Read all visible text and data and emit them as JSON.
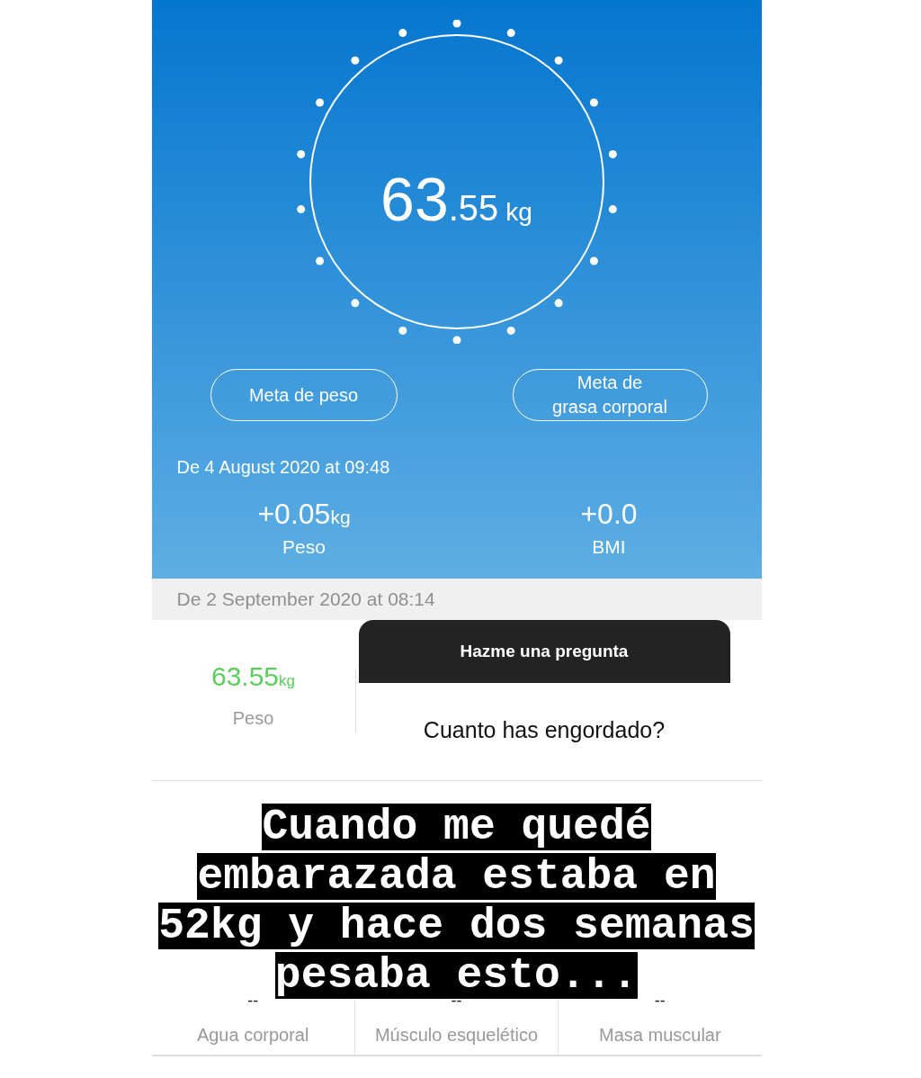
{
  "app": {
    "weight": {
      "whole": "63",
      "decimal": ".55",
      "unit": "kg"
    },
    "goal_buttons": [
      "Meta de peso",
      "Meta de\ngrasa corporal"
    ],
    "since": "De 4 August 2020 at 09:48",
    "changes": [
      {
        "value": "+0.05",
        "unit": "kg",
        "label": "Peso"
      },
      {
        "value": "+0.0",
        "label": "BMI"
      }
    ],
    "date": "De 2 September 2020 at 08:14",
    "current": {
      "value": "63.55",
      "unit": "kg",
      "label": "Peso"
    },
    "metrics": [
      {
        "value": "--",
        "label": "Agua corporal"
      },
      {
        "value": "--",
        "label": "Músculo esquelético"
      },
      {
        "value": "--",
        "label": "Masa muscular"
      }
    ]
  },
  "sticker": {
    "title": "Hazme una pregunta",
    "question": "Cuanto has engordado?"
  },
  "caption": [
    "Cuando me quedé",
    "embarazada estaba en",
    "52kg y hace dos semanas",
    "pesaba esto..."
  ]
}
